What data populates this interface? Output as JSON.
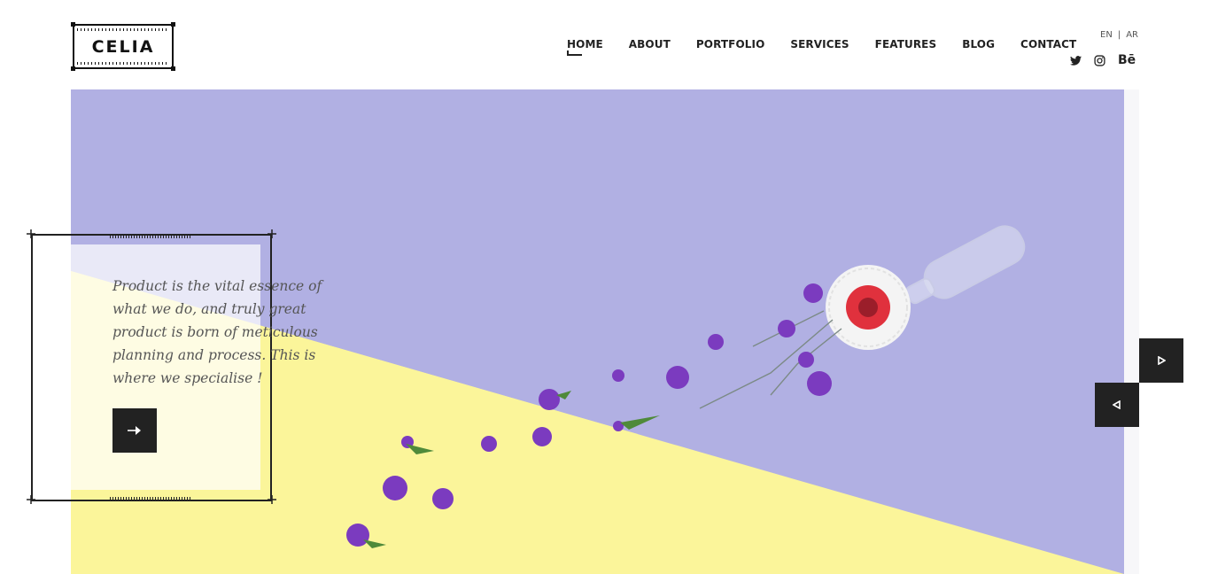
{
  "brand": {
    "logo_text": "CELIA"
  },
  "nav": {
    "items": [
      {
        "label": "HOME",
        "active": true
      },
      {
        "label": "ABOUT"
      },
      {
        "label": "PORTFOLIO"
      },
      {
        "label": "SERVICES"
      },
      {
        "label": "FEATURES"
      },
      {
        "label": "BLOG"
      },
      {
        "label": "CONTACT"
      }
    ]
  },
  "language": {
    "options": [
      "EN",
      "AR"
    ],
    "separator": "|"
  },
  "social": {
    "icons": [
      "twitter-icon",
      "instagram-icon",
      "behance-icon"
    ],
    "behance_text": "Bē"
  },
  "hero": {
    "tagline": "Product is the vital essence of what we do, and truly great product is born of meticulous planning and process. This is where we specialise !",
    "colors": {
      "lavender": "#b1b0e3",
      "yellow": "#fbf59a",
      "dark": "#222222"
    }
  },
  "slider": {
    "next_icon": "play-right-icon",
    "prev_icon": "play-left-icon",
    "cta_icon": "arrow-right-icon"
  }
}
